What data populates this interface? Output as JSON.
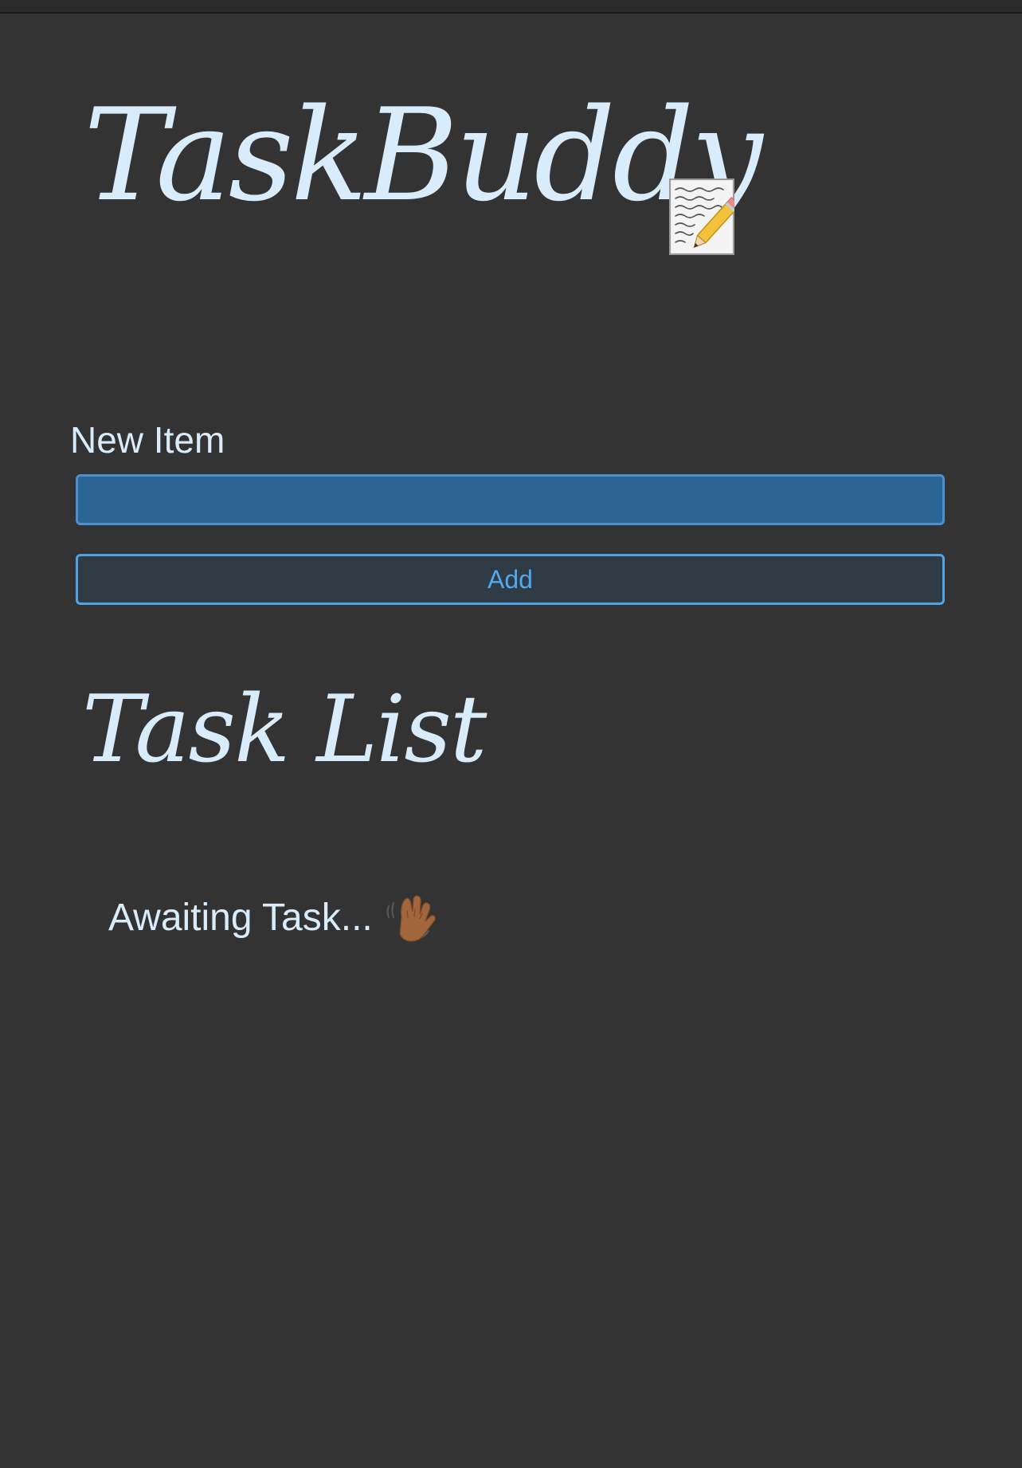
{
  "app": {
    "title": "TaskBuddy",
    "title_icon": "memo-pencil-icon"
  },
  "form": {
    "label": "New Item",
    "input_value": "",
    "input_placeholder": "",
    "add_label": "Add"
  },
  "task_list": {
    "heading": "Task List",
    "empty_message": "Awaiting Task...",
    "empty_icon": "waving-hand-icon"
  },
  "colors": {
    "background": "#333333",
    "text": "#d8ecfb",
    "input_fill": "#2b6594",
    "accent": "#4fa3e5"
  }
}
